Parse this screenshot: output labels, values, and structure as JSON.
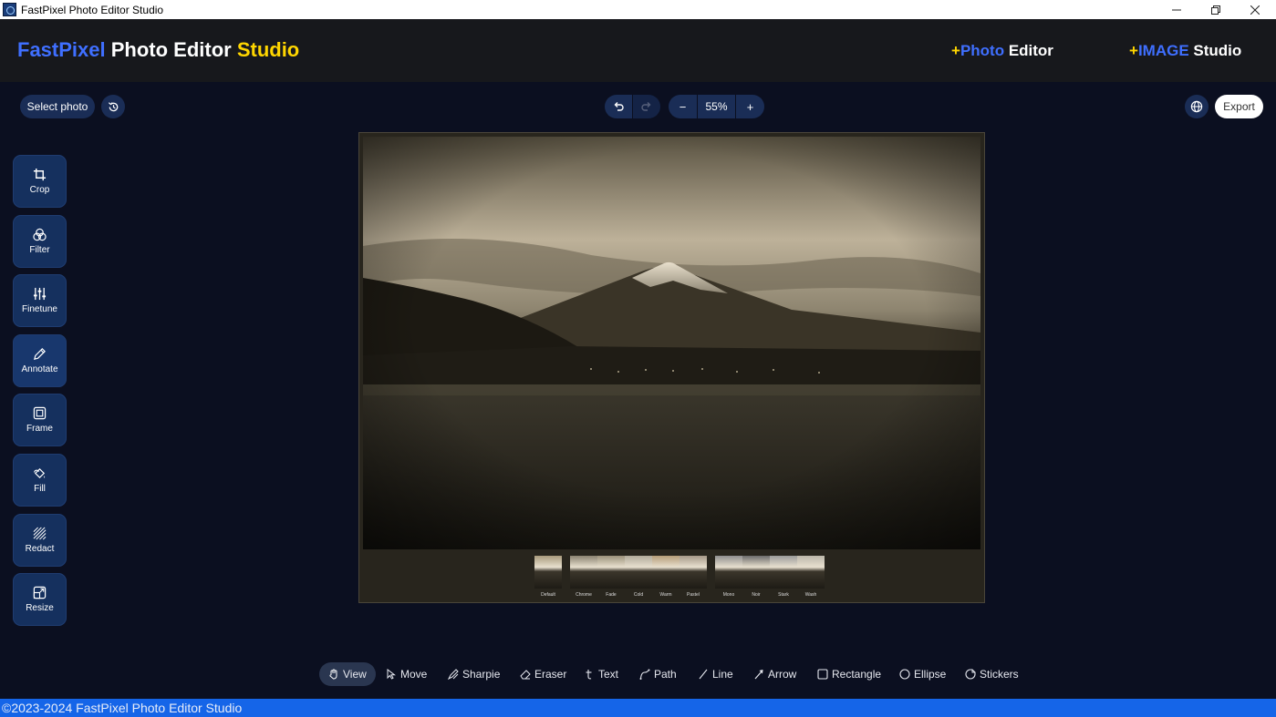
{
  "window": {
    "title": "FastPixel Photo Editor Studio",
    "minimize_icon": "minimize-icon",
    "restore_icon": "restore-icon",
    "close_icon": "close-icon"
  },
  "header": {
    "brand": {
      "part1": "FastPixel",
      "part2": " Photo Editor ",
      "part3": "Studio"
    },
    "link1": {
      "plus": "+",
      "accent": "Photo",
      "rest": " Editor"
    },
    "link2": {
      "plus": "+",
      "accent": "IMAGE",
      "rest": " Studio"
    }
  },
  "toolbar": {
    "select_photo": "Select photo",
    "zoom_out": "−",
    "zoom_level": "55%",
    "zoom_in": "+",
    "export": "Export"
  },
  "sidebar": {
    "items": [
      {
        "label": "Crop",
        "icon": "crop-icon"
      },
      {
        "label": "Filter",
        "icon": "filter-icon"
      },
      {
        "label": "Finetune",
        "icon": "sliders-icon"
      },
      {
        "label": "Annotate",
        "icon": "pencil-icon"
      },
      {
        "label": "Frame",
        "icon": "frame-icon"
      },
      {
        "label": "Fill",
        "icon": "fill-icon"
      },
      {
        "label": "Redact",
        "icon": "redact-icon"
      },
      {
        "label": "Resize",
        "icon": "resize-icon"
      }
    ]
  },
  "filters": {
    "items": [
      {
        "label": "Default"
      },
      {
        "label": "Chrome"
      },
      {
        "label": "Fade"
      },
      {
        "label": "Cold"
      },
      {
        "label": "Warm"
      },
      {
        "label": "Pastel"
      },
      {
        "label": "Mono"
      },
      {
        "label": "Noir"
      },
      {
        "label": "Stark"
      },
      {
        "label": "Wash"
      }
    ]
  },
  "annotate_tools": {
    "items": [
      {
        "label": "View",
        "icon": "hand-icon"
      },
      {
        "label": "Move",
        "icon": "cursor-icon"
      },
      {
        "label": "Sharpie",
        "icon": "sharpie-icon"
      },
      {
        "label": "Eraser",
        "icon": "eraser-icon"
      },
      {
        "label": "Text",
        "icon": "text-icon"
      },
      {
        "label": "Path",
        "icon": "path-icon"
      },
      {
        "label": "Line",
        "icon": "line-icon"
      },
      {
        "label": "Arrow",
        "icon": "arrow-icon"
      },
      {
        "label": "Rectangle",
        "icon": "rectangle-icon"
      },
      {
        "label": "Ellipse",
        "icon": "ellipse-icon"
      },
      {
        "label": "Stickers",
        "icon": "stickers-icon"
      }
    ]
  },
  "footer": {
    "text": "©2023-2024 FastPixel Photo Editor Studio"
  },
  "colors": {
    "brand_blue": "#3f6fff",
    "brand_yellow": "#ffd600",
    "button_bg": "#1a2d56",
    "footer_bg": "#1565e8"
  }
}
